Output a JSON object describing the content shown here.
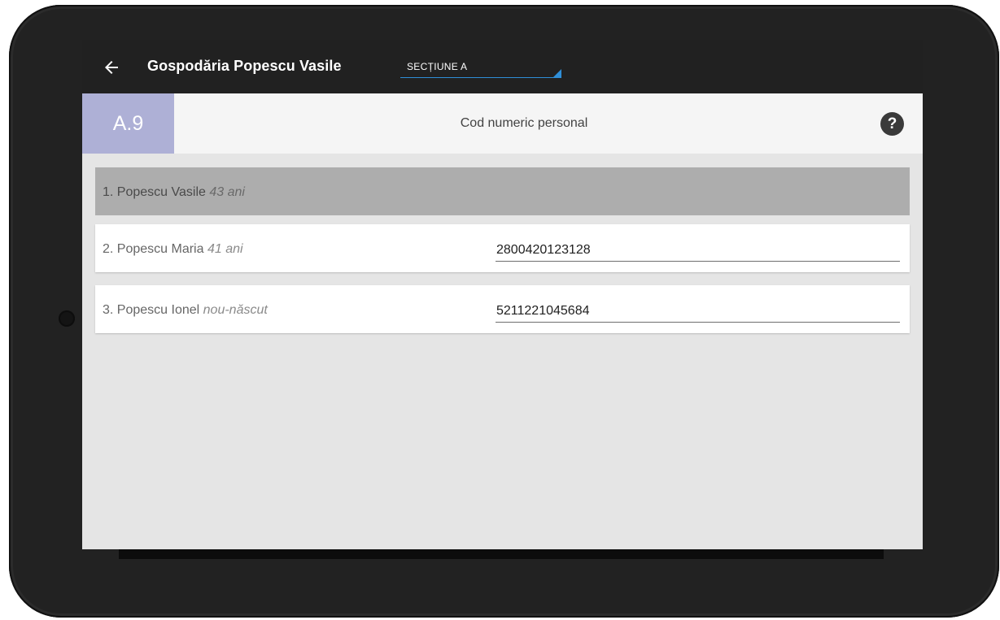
{
  "appbar": {
    "title": "Gospodăria Popescu Vasile",
    "section_select": {
      "value": "SECȚIUNE A",
      "accent": "#2f8fd8"
    },
    "back_icon": "arrow-left-icon"
  },
  "question": {
    "code": "A.9",
    "label": "Cod numeric personal",
    "code_bg": "#aeb0d6",
    "help_icon": "question-mark-icon",
    "help_glyph": "?"
  },
  "members": [
    {
      "label": "1. Popescu Vasile",
      "age": "43 ani",
      "cnp": "",
      "selected": true
    },
    {
      "label": "2. Popescu Maria",
      "age": "41 ani",
      "cnp": "2800420123128",
      "selected": false
    },
    {
      "label": "3. Popescu Ionel",
      "age": "nou-născut",
      "cnp": "5211221045684",
      "selected": false
    }
  ]
}
